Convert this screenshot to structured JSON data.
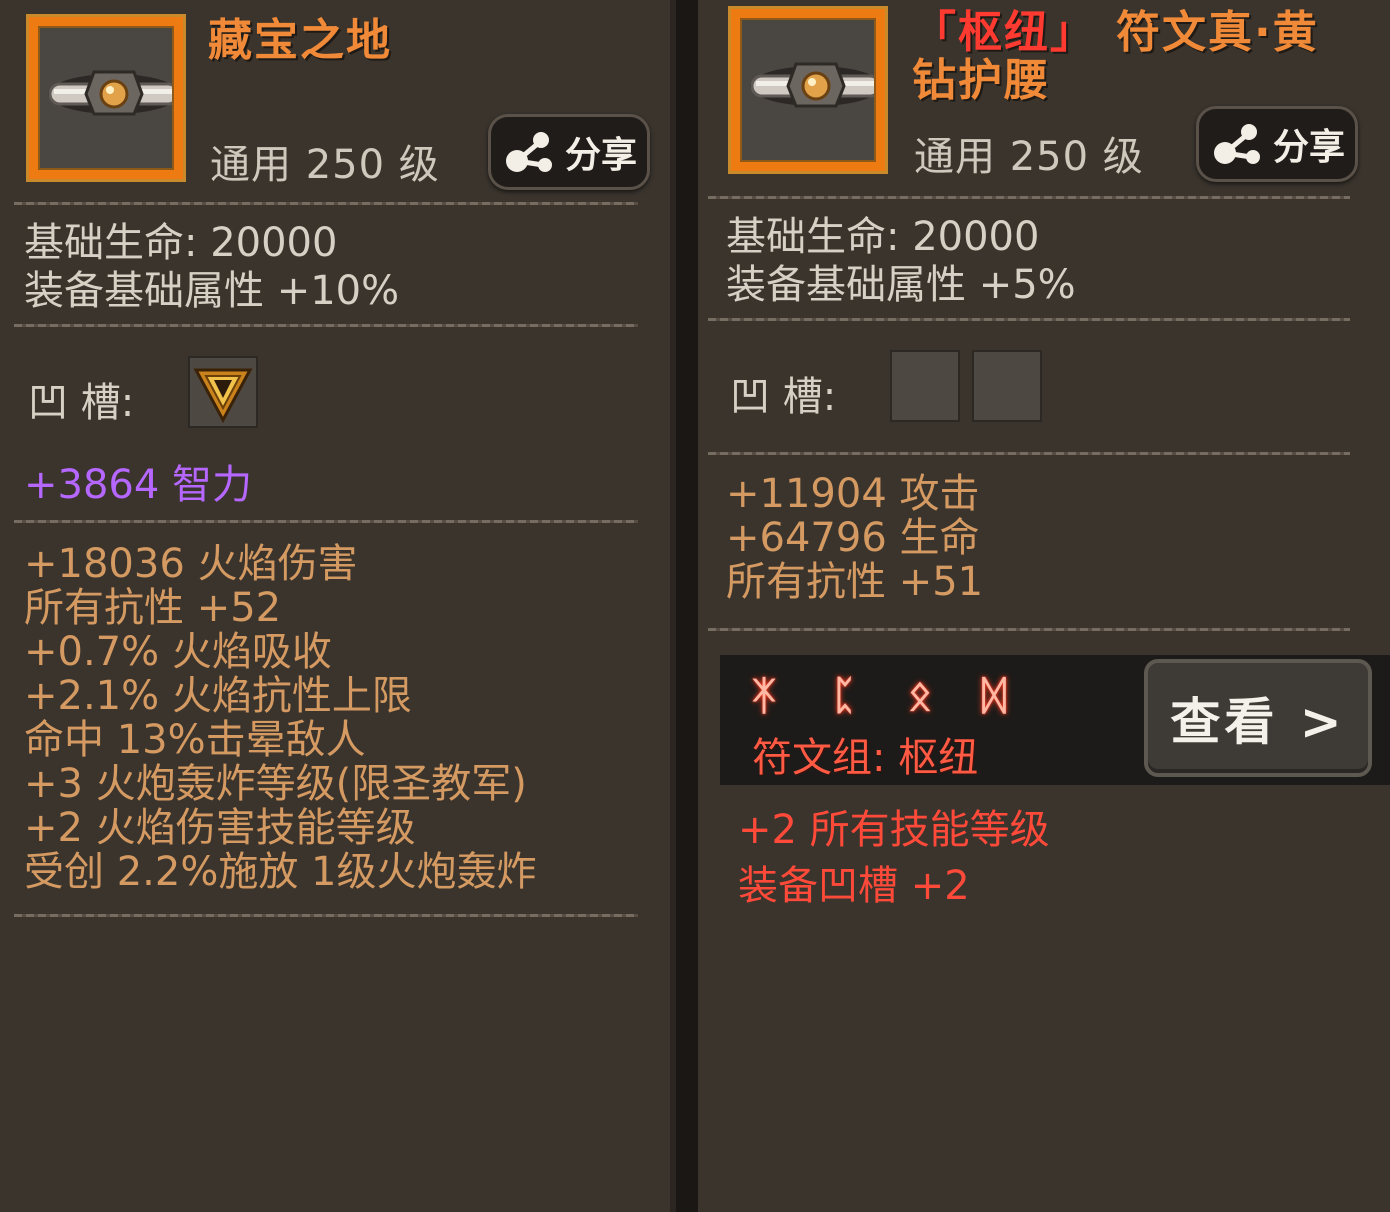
{
  "left_item": {
    "name": "藏宝之地",
    "level_text": "通用  250 级",
    "share_label": "分享",
    "base_stats": [
      "基础生命:  20000",
      "装备基础属性 +10%"
    ],
    "socket_label": "凹    槽:",
    "socket_bonus": "+3864 智力",
    "affixes": [
      "+18036 火焰伤害",
      "所有抗性 +52",
      "+0.7% 火焰吸收",
      "+2.1% 火焰抗性上限",
      "命中 13%击晕敌人",
      "+3 火炮轰炸等级(限圣教军)",
      "+2 火焰伤害技能等级",
      "受创 2.2%施放 1级火炮轰炸"
    ]
  },
  "right_item": {
    "name_prefix": "「枢纽」",
    "name_line1": "符文真·黄",
    "name_line2": "钻护腰",
    "level_text": "通用  250 级",
    "share_label": "分享",
    "base_stats": [
      "基础生命:  20000",
      "装备基础属性 +5%"
    ],
    "socket_label": "凹    槽:",
    "affixes": [
      "+11904 攻击",
      "+64796 生命",
      "所有抗性 +51"
    ],
    "runes": [
      "ᛡ",
      "ᛈ",
      "ᛟ",
      "ᛞ"
    ],
    "rune_group": "符文组:  枢纽",
    "view_button": "查看 >",
    "set_bonuses": [
      "+2 所有技能等级",
      "装备凹槽 +2"
    ]
  },
  "colors": {
    "panel_bg": "#3a342d",
    "title_orange": "#f08a38",
    "title_red": "#ff3a30",
    "affix_orange": "#d49a62",
    "socket_purple": "#b567ff",
    "set_red": "#ff4a3a"
  },
  "icons": [
    "belt-icon",
    "share-icon",
    "triangle-gem-icon"
  ]
}
